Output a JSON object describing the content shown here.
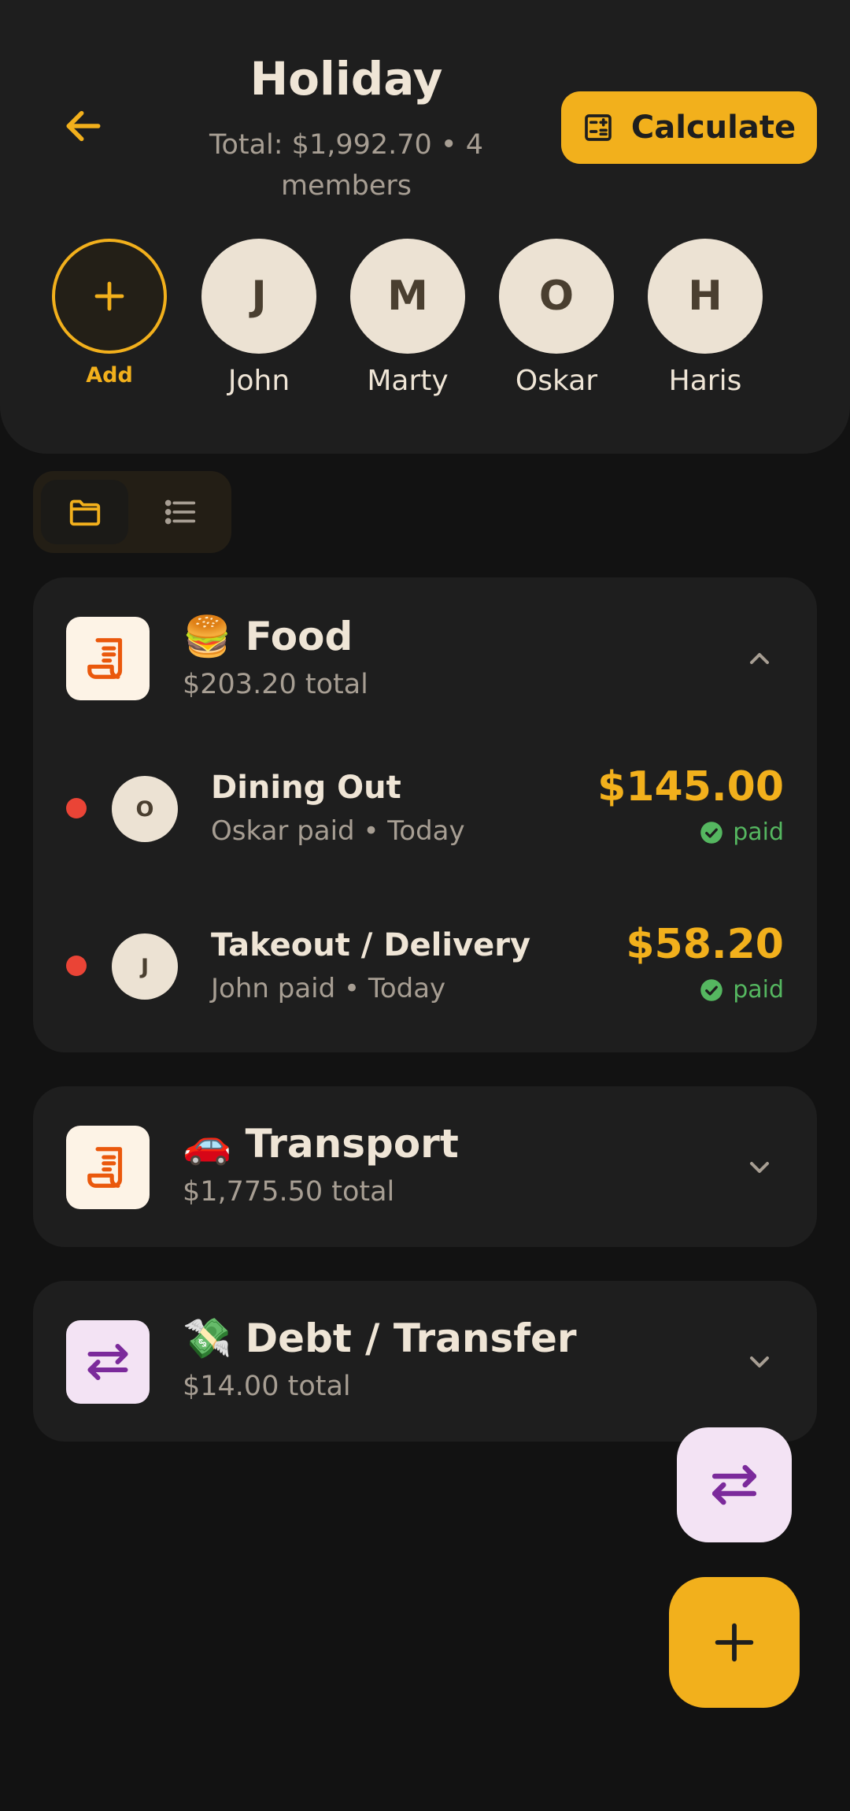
{
  "header": {
    "title": "Holiday",
    "subtitle": "Total: $1,992.70 • 4 members",
    "calculate_label": "Calculate"
  },
  "members": {
    "add_label": "Add",
    "list": [
      {
        "initial": "J",
        "name": "John"
      },
      {
        "initial": "M",
        "name": "Marty"
      },
      {
        "initial": "O",
        "name": "Oskar"
      },
      {
        "initial": "H",
        "name": "Haris"
      }
    ]
  },
  "categories": [
    {
      "title": "🍔 Food",
      "total": "$203.20 total",
      "expanded": true,
      "icon": "receipt-icon",
      "expenses": [
        {
          "initial": "O",
          "name": "Dining Out",
          "meta": "Oskar paid • Today",
          "amount": "$145.00",
          "status": "paid"
        },
        {
          "initial": "J",
          "name": "Takeout / Delivery",
          "meta": "John paid • Today",
          "amount": "$58.20",
          "status": "paid"
        }
      ]
    },
    {
      "title": "🚗 Transport",
      "total": "$1,775.50 total",
      "expanded": false,
      "icon": "receipt-icon"
    },
    {
      "title": "💸 Debt / Transfer",
      "total": "$14.00 total",
      "expanded": false,
      "icon": "transfer-icon"
    }
  ],
  "colors": {
    "accent": "#f2b01c",
    "background": "#121212",
    "surface": "#1e1e1e",
    "paid": "#55b760",
    "unpaid_dot": "#ea4436",
    "transfer_purple": "#7b2a9b"
  }
}
